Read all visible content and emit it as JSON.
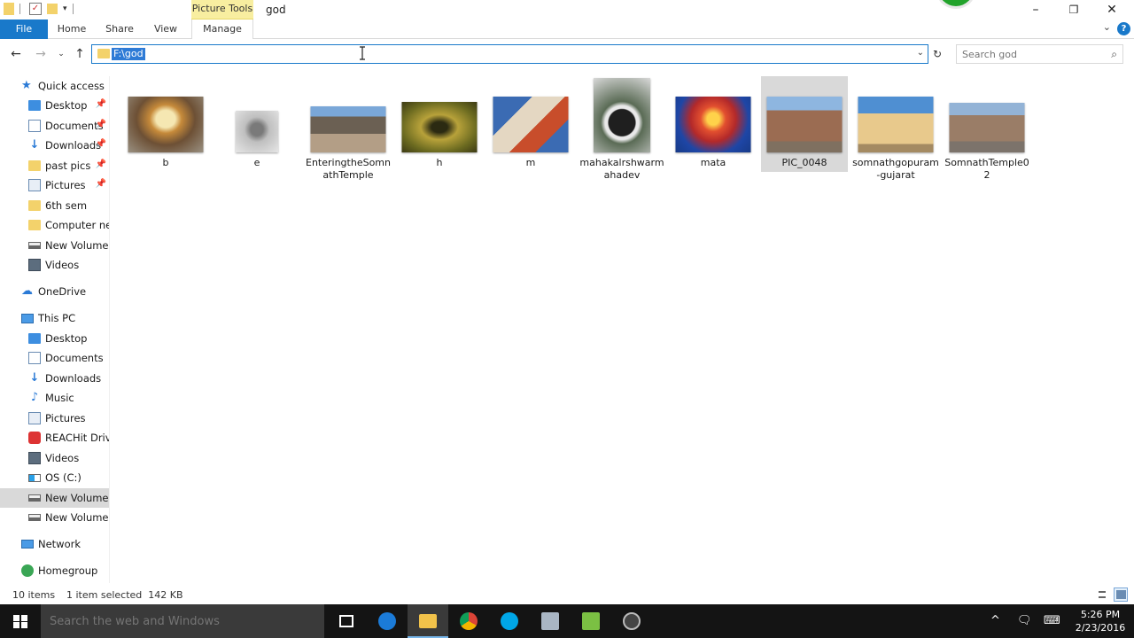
{
  "window": {
    "title": "god",
    "context_tab_group": "Picture Tools"
  },
  "ribbon": {
    "tabs": [
      {
        "label": "File"
      },
      {
        "label": "Home"
      },
      {
        "label": "Share"
      },
      {
        "label": "View"
      },
      {
        "label": "Manage"
      }
    ]
  },
  "address": {
    "path": "F:\\god",
    "search_placeholder": "Search god"
  },
  "nav": {
    "quick_access": "Quick access",
    "quick_items": [
      {
        "label": "Desktop",
        "icon": "desktop-icon",
        "pinned": true
      },
      {
        "label": "Documents",
        "icon": "documents-icon",
        "pinned": true
      },
      {
        "label": "Downloads",
        "icon": "downloads-icon",
        "pinned": true
      },
      {
        "label": "past pics",
        "icon": "folder-icon",
        "pinned": true
      },
      {
        "label": "Pictures",
        "icon": "pictures-icon",
        "pinned": true
      },
      {
        "label": "6th sem",
        "icon": "folder-icon",
        "pinned": false
      },
      {
        "label": "Computer netw",
        "icon": "folder-icon",
        "pinned": false
      },
      {
        "label": "New Volume (F",
        "icon": "drive-icon",
        "pinned": false
      },
      {
        "label": "Videos",
        "icon": "videos-icon",
        "pinned": false
      }
    ],
    "onedrive": "OneDrive",
    "this_pc": "This PC",
    "pc_items": [
      {
        "label": "Desktop",
        "icon": "desktop-icon"
      },
      {
        "label": "Documents",
        "icon": "documents-icon"
      },
      {
        "label": "Downloads",
        "icon": "downloads-icon"
      },
      {
        "label": "Music",
        "icon": "music-icon"
      },
      {
        "label": "Pictures",
        "icon": "pictures-icon"
      },
      {
        "label": "REACHit Drive",
        "icon": "reachit-icon"
      },
      {
        "label": "Videos",
        "icon": "videos-icon"
      },
      {
        "label": "OS (C:)",
        "icon": "os-drive-icon"
      },
      {
        "label": "New Volume (E",
        "icon": "drive-icon",
        "selected": true
      },
      {
        "label": "New Volume (",
        "icon": "drive-icon"
      }
    ],
    "network": "Network",
    "homegroup": "Homegroup"
  },
  "files": [
    {
      "name": "b",
      "selected": false
    },
    {
      "name": "e",
      "selected": false
    },
    {
      "name": "EnteringtheSomnathTemple",
      "selected": false
    },
    {
      "name": "h",
      "selected": false
    },
    {
      "name": "m",
      "selected": false
    },
    {
      "name": "mahakalrshwarmahadev",
      "selected": false
    },
    {
      "name": "mata",
      "selected": false
    },
    {
      "name": "PIC_0048",
      "selected": true
    },
    {
      "name": "somnathgopuram-gujarat",
      "selected": false
    },
    {
      "name": "SomnathTemple02",
      "selected": false
    }
  ],
  "status": {
    "item_count": "10 items",
    "selection": "1 item selected  142 KB"
  },
  "taskbar": {
    "search_placeholder": "Search the web and Windows",
    "time": "5:26 PM",
    "date": "2/23/2016"
  },
  "colors": {
    "accent": "#1979ca",
    "context_tab": "#f8eea0",
    "selection": "#d9d9d9",
    "taskbar": "#141414"
  }
}
